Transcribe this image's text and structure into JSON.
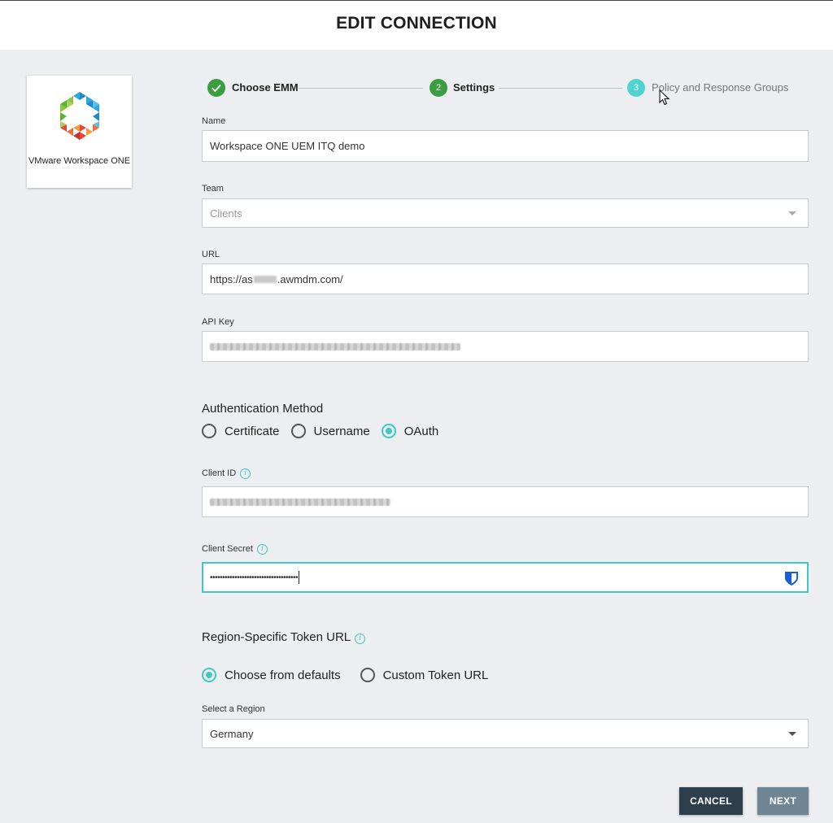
{
  "header": {
    "title": "EDIT CONNECTION"
  },
  "provider": {
    "name": "VMware Workspace ONE"
  },
  "stepper": {
    "steps": [
      {
        "number": "",
        "label": "Choose EMM",
        "state": "done"
      },
      {
        "number": "2",
        "label": "Settings",
        "state": "active"
      },
      {
        "number": "3",
        "label": "Policy and Response Groups",
        "state": "pending"
      }
    ]
  },
  "form": {
    "name": {
      "label": "Name",
      "value": "Workspace ONE UEM ITQ demo"
    },
    "team": {
      "label": "Team",
      "placeholder": "Clients"
    },
    "url": {
      "label": "URL",
      "value_prefix": "https://as",
      "value_suffix": ".awmdm.com/"
    },
    "api_key": {
      "label": "API Key"
    },
    "auth_method": {
      "title": "Authentication Method",
      "options": [
        "Certificate",
        "Username",
        "OAuth"
      ],
      "selected": "OAuth"
    },
    "client_id": {
      "label": "Client ID"
    },
    "client_secret": {
      "label": "Client Secret",
      "value": "••••••••••••••••••••••••••••••••••••"
    },
    "token_url": {
      "title": "Region-Specific Token URL",
      "options": [
        "Choose from defaults",
        "Custom Token URL"
      ],
      "selected": "Choose from defaults"
    },
    "region": {
      "label": "Select a Region",
      "value": "Germany"
    }
  },
  "actions": {
    "cancel": "CANCEL",
    "next": "NEXT"
  },
  "colors": {
    "accent": "#3fc8c4",
    "success": "#3a9d3f",
    "cancel_bg": "#2d3e4d",
    "next_bg": "#6f8593"
  }
}
